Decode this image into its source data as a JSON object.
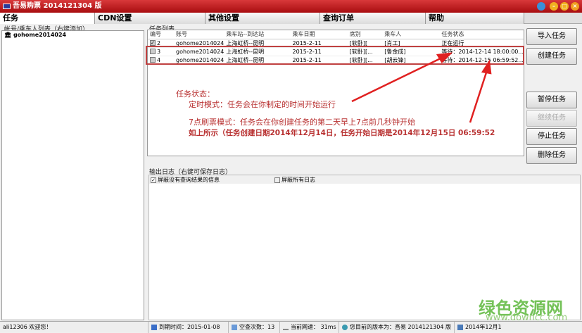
{
  "window": {
    "title": "吾易购票 2014121304 版"
  },
  "tabs": [
    "任务",
    "CDN设置",
    "其他设置",
    "查询订单",
    "帮助"
  ],
  "left": {
    "label": "帐号/乘车人列表（右键添加）",
    "accounts": [
      "gohome2014024"
    ]
  },
  "tasklist": {
    "label": "任务列表",
    "columns": [
      "编号",
      "账号",
      "乘车站--到达站",
      "乘车日期",
      "席别",
      "乘车人",
      "任务状态"
    ],
    "rows": [
      {
        "checked": true,
        "id": "2",
        "account": "gohome2014024",
        "route": "上海虹桥--昆明",
        "date": "2015-2-11",
        "seat": "[软卧][",
        "passenger": "[肖工]",
        "status": "正在运行"
      },
      {
        "checked": false,
        "id": "3",
        "account": "gohome2014024",
        "route": "上海虹桥--昆明",
        "date": "2015-2-11",
        "seat": "[软卧][...",
        "passenger": "[鲁金成]",
        "status": "等待：2014-12-14 18:00:00..."
      },
      {
        "checked": false,
        "id": "4",
        "account": "gohome2014024",
        "route": "上海虹桥--昆明",
        "date": "2015-2-11",
        "seat": "[软卧][...",
        "passenger": "[胡云锋]",
        "status": "等待：2014-12-15 06:59:52..."
      }
    ]
  },
  "buttons": {
    "import": "导入任务",
    "create": "创建任务",
    "pause": "暂停任务",
    "resume": "继续任务",
    "stop": "停止任务",
    "delete": "删除任务"
  },
  "log": {
    "label": "输出日志（右键可保存日志）",
    "opt1": "屏蔽没有查询结果的信息",
    "opt2": "屏蔽所有日志",
    "opt1_checked": true,
    "opt2_checked": false
  },
  "annotation": {
    "line1": "任务状态：",
    "line2": "定时模式：任务会在你制定的时间开始运行",
    "line3": "7点刷票模式：任务会在你创建任务的第二天早上7点前几秒钟开始",
    "line4": "如上所示（任务创建日期2014年12月14日，任务开始日期是2014年12月15日 06:59:52"
  },
  "status": {
    "user": "ali12306 欢迎您！",
    "expire": "到期时间：2015-01-08",
    "queries": "空查次数：13",
    "speed": "当前网速：  31ms",
    "version": "您目前的版本为：吾易 2014121304 版",
    "date": "2014年12月1"
  },
  "watermark": {
    "name": "绿色资源网",
    "url": "www.downcc.com"
  },
  "colors": {
    "title": "#c01a1d",
    "annotation": "#b83030",
    "arrow": "#e02020"
  }
}
